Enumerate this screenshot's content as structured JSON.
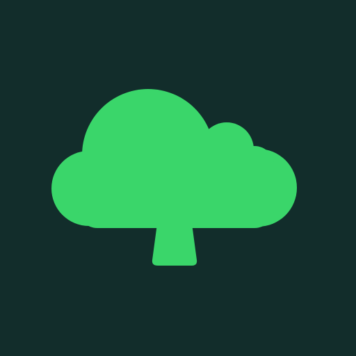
{
  "app_icon": {
    "icon_name": "tree-cloud-icon",
    "background_color": "#122d2b",
    "foreground_color": "#3ad66a"
  }
}
